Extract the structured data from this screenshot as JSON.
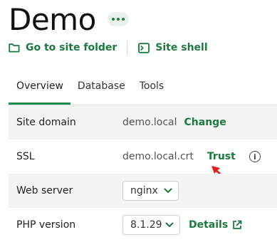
{
  "header": {
    "title": "Demo",
    "more_icon": "more-horizontal-icon",
    "actions": [
      {
        "label": "Go to site folder",
        "icon": "folder-icon"
      },
      {
        "label": "Site shell",
        "icon": "terminal-icon"
      }
    ]
  },
  "tabs": [
    {
      "label": "Overview",
      "active": true
    },
    {
      "label": "Database",
      "active": false
    },
    {
      "label": "Tools",
      "active": false
    }
  ],
  "rows": {
    "site_domain": {
      "label": "Site domain",
      "value": "demo.local",
      "action": "Change"
    },
    "ssl": {
      "label": "SSL",
      "value": "demo.local.crt",
      "action": "Trust",
      "info_icon": "info-icon"
    },
    "web_server": {
      "label": "Web server",
      "selected": "nginx"
    },
    "php_version": {
      "label": "PHP version",
      "selected": "8.1.29",
      "action": "Details",
      "action_icon": "external-link-icon"
    }
  },
  "colors": {
    "accent": "#1d7a3f",
    "annotation_arrow": "#e0201b",
    "row_shade": "#f4f4f4"
  }
}
